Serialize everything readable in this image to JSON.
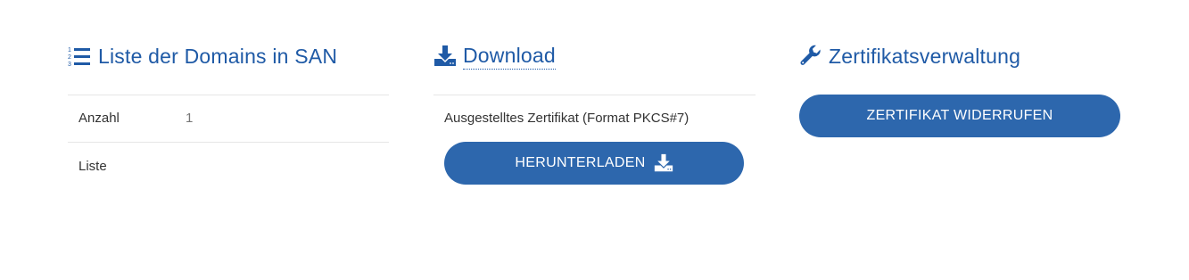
{
  "san_section": {
    "title": "Liste der Domains in SAN",
    "icon": "ordered-list-icon",
    "rows": [
      {
        "label": "Anzahl",
        "value": "1"
      },
      {
        "label": "Liste",
        "value": ""
      }
    ]
  },
  "download_section": {
    "title": "Download",
    "icon": "download-icon",
    "description": "Ausgestelltes Zertifikat (Format PKCS#7)",
    "button_label": "HERUNTERLADEN",
    "button_icon": "download-icon"
  },
  "cert_section": {
    "title": "Zertifikatsverwaltung",
    "icon": "wrench-icon",
    "button_label": "ZERTIFIKAT WIDERRUFEN"
  },
  "colors": {
    "accent": "#1f5aa6",
    "button": "#2d67ad",
    "divider": "#e6e6e6"
  }
}
